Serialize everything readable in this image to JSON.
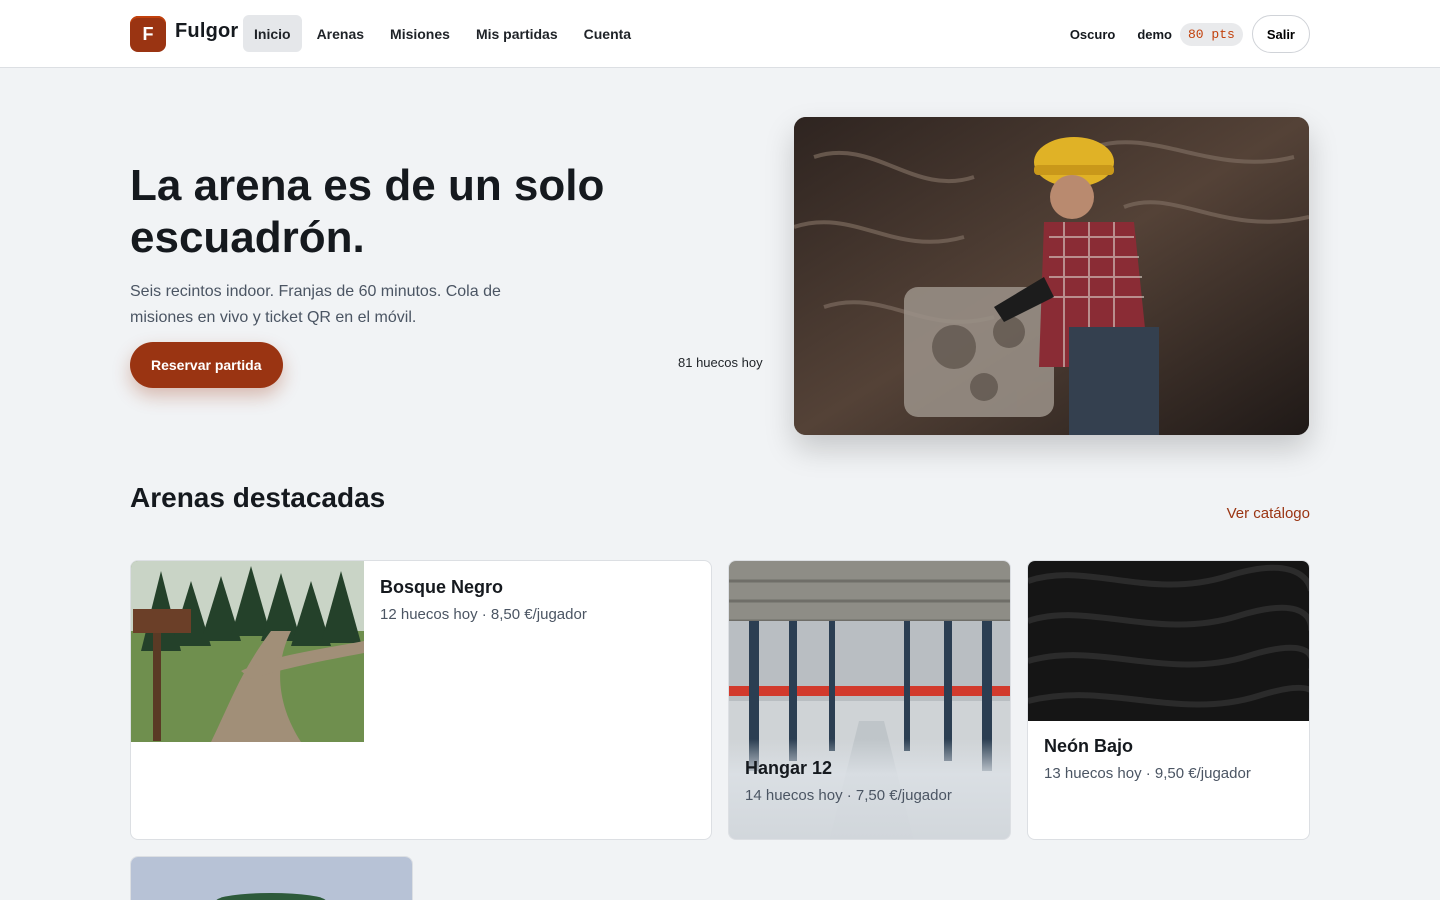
{
  "brand": {
    "initial": "F",
    "name": "Fulgor"
  },
  "nav": {
    "items": [
      {
        "label": "Inicio",
        "active": true
      },
      {
        "label": "Arenas",
        "active": false
      },
      {
        "label": "Misiones",
        "active": false
      },
      {
        "label": "Mis partidas",
        "active": false
      },
      {
        "label": "Cuenta",
        "active": false
      }
    ]
  },
  "user": {
    "theme_label": "Oscuro",
    "name": "demo",
    "points": "80 pts",
    "logout_label": "Salir"
  },
  "hero": {
    "title": "La arena es de un solo escuadrón.",
    "subtitle": "Seis recintos indoor. Franjas de 60 minutos. Cola de misiones en vivo y ticket QR en el móvil.",
    "cta_label": "Reservar partida",
    "slots_today": "81 huecos hoy",
    "image_alt": "Mecánica trabajando en un motor"
  },
  "featured": {
    "title": "Arenas destacadas",
    "link_label": "Ver catálogo",
    "arenas": [
      {
        "name": "Bosque Negro",
        "meta": "12 huecos hoy · 8,50 €/jugador"
      },
      {
        "name": "Hangar 12",
        "meta": "14 huecos hoy · 7,50 €/jugador"
      },
      {
        "name": "Neón Bajo",
        "meta": "13 huecos hoy · 9,50 €/jugador"
      }
    ]
  },
  "colors": {
    "accent": "#9a3412",
    "points": "#c2410c",
    "background": "#f1f3f5"
  }
}
